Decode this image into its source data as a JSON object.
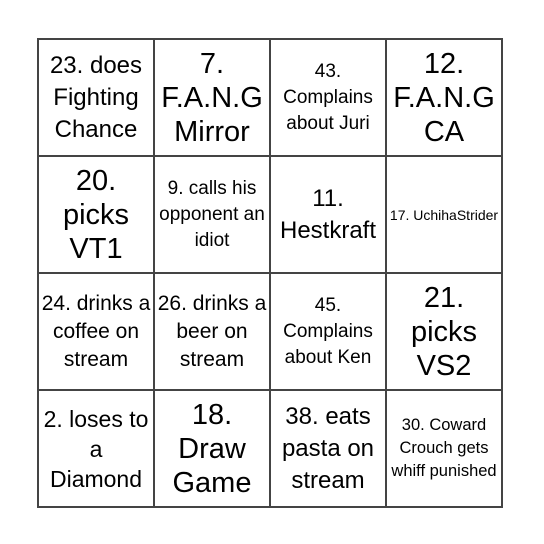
{
  "cells": [
    [
      "23. does Fighting Chance",
      "7. F.A.N.G Mirror",
      "43. Complains about Juri",
      "12. F.A.N.G CA"
    ],
    [
      "20. picks VT1",
      "9. calls his opponent an idiot",
      "11. Hestkraft",
      "17. UchihaStrider"
    ],
    [
      "24. drinks a coffee on stream",
      "26. drinks a beer on stream",
      "45. Complains about Ken",
      "21. picks VS2"
    ],
    [
      "2. loses to a Diamond",
      "18. Draw Game",
      "38. eats pasta on stream",
      "30. Coward Crouch gets whiff punished"
    ]
  ]
}
